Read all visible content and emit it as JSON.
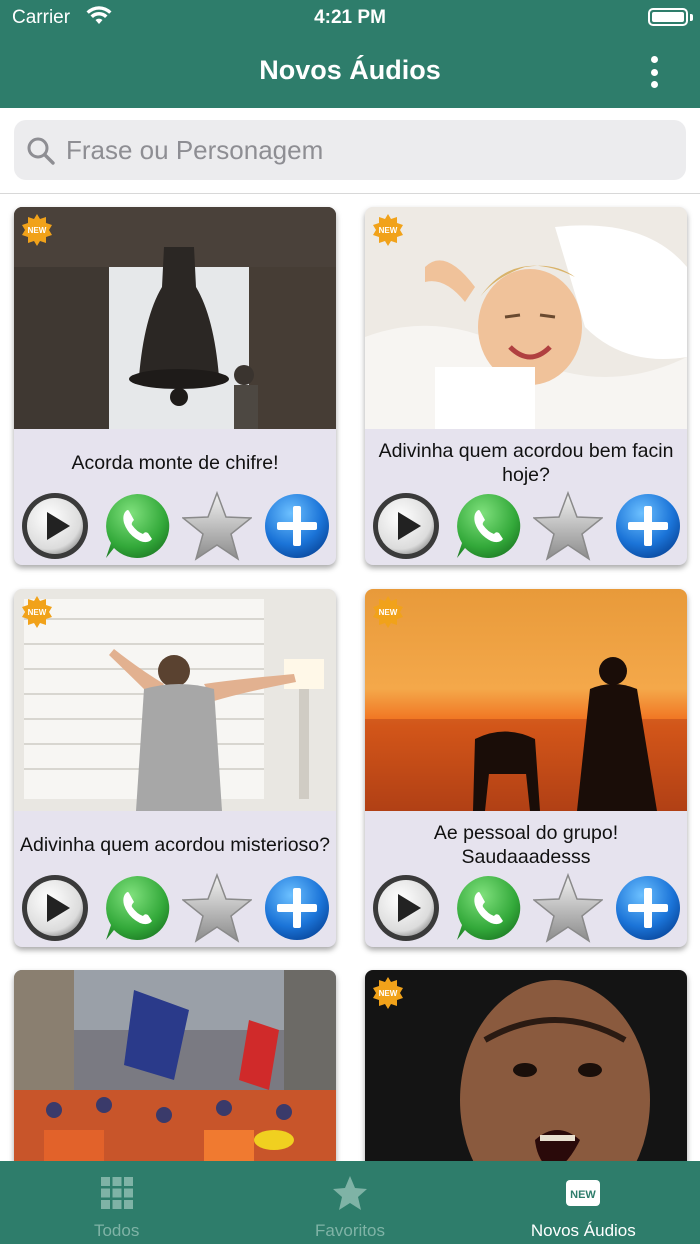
{
  "status": {
    "carrier": "Carrier",
    "time": "4:21 PM"
  },
  "nav": {
    "title": "Novos Áudios"
  },
  "search": {
    "placeholder": "Frase ou Personagem"
  },
  "cards": [
    {
      "caption": "Acorda monte de chifre!",
      "badge": "NEW",
      "image": "church-bell"
    },
    {
      "caption": "Adivinha quem acordou bem facin hoje?",
      "badge": "NEW",
      "image": "woman-waking-in-bed"
    },
    {
      "caption": "Adivinha quem acordou misterioso?",
      "badge": "NEW",
      "image": "man-stretching-at-window"
    },
    {
      "caption": "Ae pessoal do grupo! Saudaaadesss",
      "badge": "NEW",
      "image": "silhouette-sunset-beach"
    },
    {
      "caption": "",
      "badge": "",
      "image": "street-protest-crowd"
    },
    {
      "caption": "",
      "badge": "NEW",
      "image": "angry-shouting-man"
    }
  ],
  "actions": [
    "play-icon",
    "whatsapp-icon",
    "star-icon",
    "plus-icon"
  ],
  "tabs": [
    {
      "label": "Todos",
      "icon": "grid-icon",
      "active": false
    },
    {
      "label": "Favoritos",
      "icon": "star-icon",
      "active": false
    },
    {
      "label": "Novos Áudios",
      "icon": "new-icon",
      "active": true
    }
  ],
  "colors": {
    "primary": "#2e7d6b",
    "card": "#e6e3ee",
    "tab_inactive": "#7fb3a6",
    "whatsapp": "#3fb94a",
    "plus": "#1e7fe0"
  }
}
